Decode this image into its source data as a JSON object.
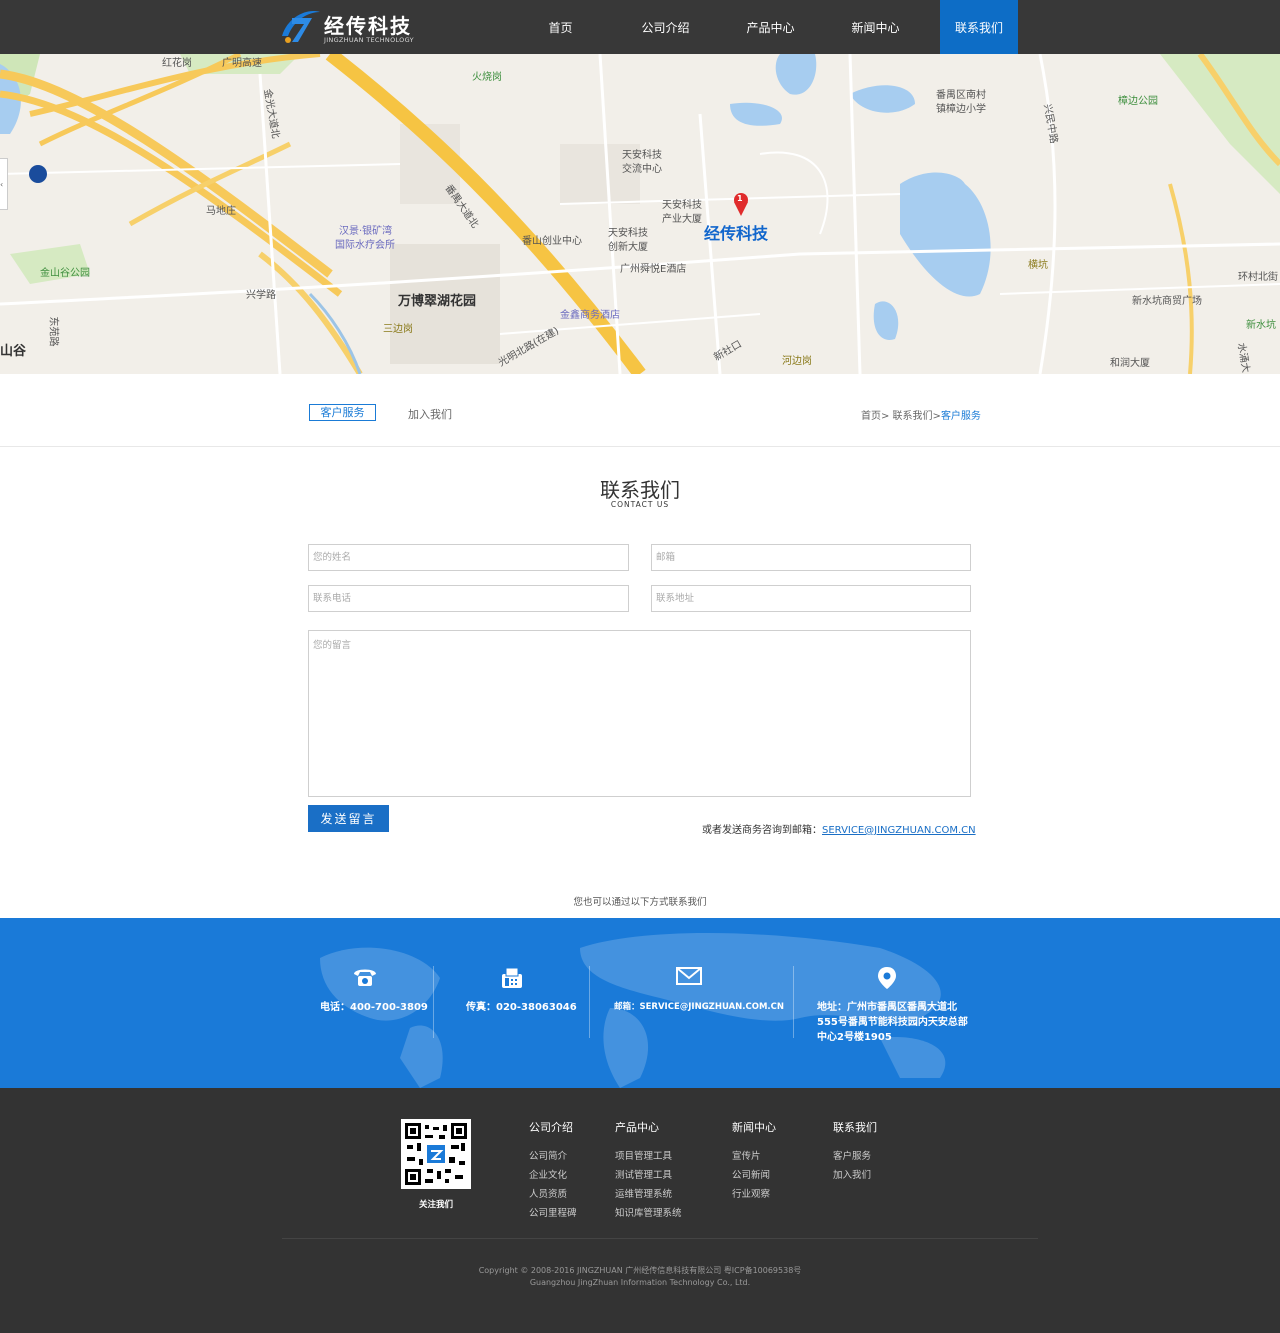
{
  "header": {
    "logo_cn": "经传科技",
    "logo_en": "JINGZHUAN TECHNOLOGY",
    "nav": [
      {
        "label": "首页"
      },
      {
        "label": "公司介绍"
      },
      {
        "label": "产品中心"
      },
      {
        "label": "新闻中心"
      },
      {
        "label": "联系我们"
      }
    ],
    "accent": "#0d6dc6",
    "bg": "#383838"
  },
  "map": {
    "company": "经传科技",
    "marker_number": "1",
    "labels": {
      "huoshaogang": "火烧岗",
      "honghuagang": "红花岗",
      "guangming": "广明高速",
      "jinguang": "金光大道北",
      "mazhuang": "马地庄",
      "jinshangu": "金山谷公园",
      "hanjing": "汉景·银矿湾",
      "hanjing2": "国际水疗会所",
      "xingxue": "兴学路",
      "wanbo": "万博翠湖花园",
      "sanbiangang": "三边岗",
      "panyu_dadao": "番禺大道北",
      "panshan": "番山创业中心",
      "tianan1": "天安科技",
      "tianan1b": "交流中心",
      "tianan2": "天安科技",
      "tianan2b": "产业大厦",
      "tianan3": "天安科技",
      "tianan3b": "创新大厦",
      "shunyue": "广州舜悦E酒店",
      "jinxin": "金鑫商务酒店",
      "guangming_n": "光明北路(在建)",
      "xinshe": "新社口",
      "hebiangang": "河边岗",
      "nancun": "番禺区南村",
      "nancun2": "镇樟边小学",
      "zhangbian": "樟边公园",
      "hengkeng": "横坑",
      "xinshuikeng": "新水坑商贸广场",
      "huancun": "环村北街",
      "xinshuikeng2": "新水坑",
      "herun": "和润大厦",
      "shangu": "山谷",
      "dongyuan": "东苑路",
      "xingminzhong": "兴民中路",
      "shuiyong": "水涌大"
    }
  },
  "subnav": {
    "tabs": [
      {
        "label": "客户服务",
        "active": true
      },
      {
        "label": "加入我们",
        "active": false
      }
    ],
    "breadcrumb": {
      "prefix": "首页> 联系我们>",
      "current": "客户服务"
    }
  },
  "contact": {
    "title": "联系我们",
    "subtitle": "CONTACT US",
    "placeholders": {
      "name": "您的姓名",
      "email": "邮箱",
      "phone": "联系电话",
      "address": "联系地址",
      "message": "您的留言"
    },
    "send_label": "发送留言",
    "email_note": "或者发送商务咨询到邮箱：",
    "email_link": "SERVICE@JINGZHUAN.COM.CN",
    "also": "您也可以通过以下方式联系我们"
  },
  "band": {
    "bg": "#1a7ad8",
    "items": [
      {
        "icon": "phone-icon",
        "text": "电话：400-700-3809"
      },
      {
        "icon": "fax-icon",
        "text": "传真：020-38063046"
      },
      {
        "icon": "mail-icon",
        "text": "邮箱：SERVICE@JINGZHUAN.COM.CN"
      },
      {
        "icon": "location-pin-icon",
        "lines": [
          "地址：广州市番禺区番禺大道北",
          "555号番禺节能科技园内天安总部",
          "中心2号楼1905"
        ]
      }
    ]
  },
  "footer": {
    "qr_label": "关注我们",
    "columns": [
      {
        "title": "公司介绍",
        "items": [
          "公司简介",
          "企业文化",
          "人员资质",
          "公司里程碑"
        ]
      },
      {
        "title": "产品中心",
        "items": [
          "项目管理工具",
          "测试管理工具",
          "运维管理系统",
          "知识库管理系统"
        ]
      },
      {
        "title": "新闻中心",
        "items": [
          "宣传片",
          "公司新闻",
          "行业观察"
        ]
      },
      {
        "title": "联系我们",
        "items": [
          "客户服务",
          "加入我们"
        ]
      }
    ],
    "copyright1": "Copyright © 2008-2016 JINGZHUAN 广州经传信息科技有限公司 粤ICP备10069538号",
    "copyright2": "Guangzhou JingZhuan Information Technology Co., Ltd."
  }
}
